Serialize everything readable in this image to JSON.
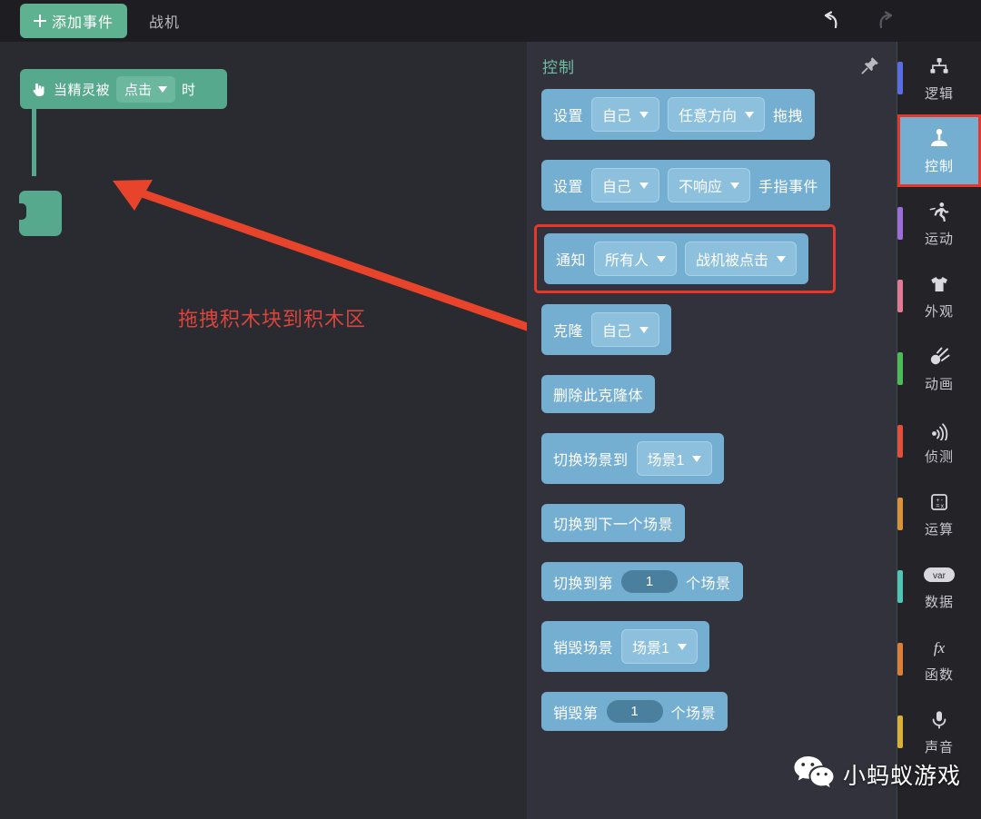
{
  "topbar": {
    "add_event_label": "添加事件",
    "add_event_icon": "plus-icon",
    "sprite_tab_label": "战机",
    "undo_icon": "undo-arrow-icon",
    "redo_icon": "redo-arrow-icon"
  },
  "canvas": {
    "hat_block": {
      "icon": "hand-pointer-icon",
      "prefix": "当精灵被",
      "dropdown_value": "点击",
      "suffix": "时",
      "color": "#56a98c"
    },
    "annotation": {
      "text": "拖拽积木块到积木区",
      "color": "#d9453b",
      "arrow_color": "#e8432b"
    }
  },
  "palette": {
    "title": "控制",
    "title_color": "#6fc0a2",
    "pin_icon": "pin-icon",
    "block_color": "#74aed0",
    "highlight_color": "#e8372a",
    "blocks": [
      {
        "name": "set-drag-block",
        "parts": [
          {
            "kind": "label",
            "text": "设置"
          },
          {
            "kind": "dropdown",
            "text": "自己"
          },
          {
            "kind": "dropdown",
            "text": "任意方向"
          },
          {
            "kind": "label",
            "text": "拖拽"
          }
        ],
        "highlighted": false
      },
      {
        "name": "set-finger-event-block",
        "parts": [
          {
            "kind": "label",
            "text": "设置"
          },
          {
            "kind": "dropdown",
            "text": "自己"
          },
          {
            "kind": "dropdown",
            "text": "不响应"
          },
          {
            "kind": "label",
            "text": "手指事件"
          }
        ],
        "highlighted": false
      },
      {
        "name": "notify-block",
        "parts": [
          {
            "kind": "label",
            "text": "通知"
          },
          {
            "kind": "dropdown",
            "text": "所有人"
          },
          {
            "kind": "dropdown",
            "text": "战机被点击"
          }
        ],
        "highlighted": true
      },
      {
        "name": "clone-block",
        "parts": [
          {
            "kind": "label",
            "text": "克隆"
          },
          {
            "kind": "dropdown",
            "text": "自己"
          }
        ],
        "highlighted": false
      },
      {
        "name": "delete-clone-block",
        "parts": [
          {
            "kind": "label",
            "text": "删除此克隆体"
          }
        ],
        "highlighted": false
      },
      {
        "name": "switch-scene-to-block",
        "parts": [
          {
            "kind": "label",
            "text": "切换场景到"
          },
          {
            "kind": "dropdown",
            "text": "场景1"
          }
        ],
        "highlighted": false
      },
      {
        "name": "switch-next-scene-block",
        "parts": [
          {
            "kind": "label",
            "text": "切换到下一个场景"
          }
        ],
        "highlighted": false
      },
      {
        "name": "switch-to-nth-scene-block",
        "parts": [
          {
            "kind": "label",
            "text": "切换到第"
          },
          {
            "kind": "number",
            "text": "1"
          },
          {
            "kind": "label",
            "text": "个场景"
          }
        ],
        "highlighted": false
      },
      {
        "name": "destroy-scene-block",
        "parts": [
          {
            "kind": "label",
            "text": "销毁场景"
          },
          {
            "kind": "dropdown",
            "text": "场景1"
          }
        ],
        "highlighted": false
      },
      {
        "name": "destroy-nth-scene-block",
        "parts": [
          {
            "kind": "label",
            "text": "销毁第"
          },
          {
            "kind": "number",
            "text": "1"
          },
          {
            "kind": "label",
            "text": "个场景"
          }
        ],
        "highlighted": false
      }
    ]
  },
  "sidebar": {
    "items": [
      {
        "name": "logic",
        "label": "逻辑",
        "icon": "sitemap-icon",
        "accent": "#5b6ee1",
        "active": false
      },
      {
        "name": "control",
        "label": "控制",
        "icon": "joystick-icon",
        "accent": "#74aed0",
        "active": true
      },
      {
        "name": "motion",
        "label": "运动",
        "icon": "running-icon",
        "accent": "#9b6ed8",
        "active": false
      },
      {
        "name": "appearance",
        "label": "外观",
        "icon": "tshirt-icon",
        "accent": "#e07b96",
        "active": false
      },
      {
        "name": "animation",
        "label": "动画",
        "icon": "comet-icon",
        "accent": "#4fba5a",
        "active": false
      },
      {
        "name": "sensing",
        "label": "侦测",
        "icon": "radar-icon",
        "accent": "#e0503f",
        "active": false
      },
      {
        "name": "operations",
        "label": "运算",
        "icon": "calculator-icon",
        "accent": "#d8943c",
        "active": false
      },
      {
        "name": "data",
        "label": "数据",
        "icon": "var-icon",
        "accent": "#52c4b6",
        "active": false
      },
      {
        "name": "functions",
        "label": "函数",
        "icon": "fx-icon",
        "accent": "#d8803c",
        "active": false
      },
      {
        "name": "sound",
        "label": "声音",
        "icon": "microphone-icon",
        "accent": "#d8b03c",
        "active": false
      }
    ]
  },
  "watermark": {
    "text": "小蚂蚁游戏",
    "icon": "wechat-icon"
  }
}
